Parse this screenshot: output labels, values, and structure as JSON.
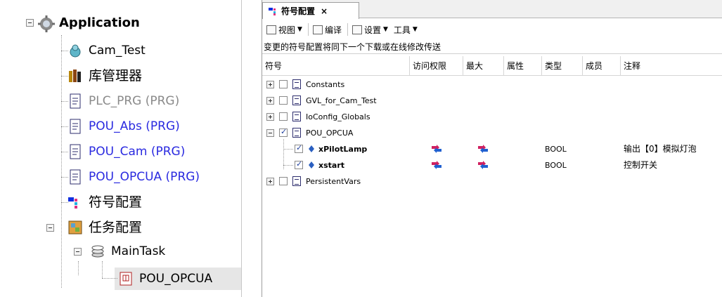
{
  "tree": {
    "items": [
      {
        "label": "Application",
        "style": "bold"
      },
      {
        "label": "Cam_Test",
        "style": "normal"
      },
      {
        "label": "库管理器",
        "style": "big"
      },
      {
        "label": "PLC_PRG (PRG)",
        "style": "gray"
      },
      {
        "label": "POU_Abs (PRG)",
        "style": "blue"
      },
      {
        "label": "POU_Cam (PRG)",
        "style": "blue"
      },
      {
        "label": "POU_OPCUA (PRG)",
        "style": "blue"
      },
      {
        "label": "符号配置",
        "style": "big"
      },
      {
        "label": "任务配置",
        "style": "big"
      },
      {
        "label": "MainTask",
        "style": "normal"
      },
      {
        "label": "POU_OPCUA",
        "style": "normal"
      }
    ]
  },
  "editor": {
    "tab_label": "符号配置",
    "tab_close": "×",
    "toolbar": {
      "view": "视图",
      "compile": "编译",
      "settings": "设置",
      "tools": "工具"
    },
    "notice": "变更的符号配置将同下一个下载或在线修改传送",
    "columns": [
      "符号",
      "访问权限",
      "最大",
      "属性",
      "类型",
      "成员",
      "注释"
    ],
    "rows": [
      {
        "symbol": "Constants",
        "checked": false,
        "expander": "plus",
        "level": 0
      },
      {
        "symbol": "GVL_for_Cam_Test",
        "checked": false,
        "expander": "plus",
        "level": 0
      },
      {
        "symbol": "IoConfig_Globals",
        "checked": false,
        "expander": "plus",
        "level": 0
      },
      {
        "symbol": "POU_OPCUA",
        "checked": true,
        "expander": "minus",
        "level": 0
      },
      {
        "symbol": "xPilotLamp",
        "checked": true,
        "level": 1,
        "type": "BOOL",
        "comment": "输出【0】模拟灯泡"
      },
      {
        "symbol": "xstart",
        "checked": true,
        "level": 1,
        "type": "BOOL",
        "comment": "控制开关"
      },
      {
        "symbol": "PersistentVars",
        "checked": false,
        "expander": "plus",
        "level": 0
      }
    ]
  },
  "colors": {
    "folder_blue": "#2a2ae0",
    "gray_text": "#8a8a8a",
    "selection": "#e6e6e6"
  }
}
